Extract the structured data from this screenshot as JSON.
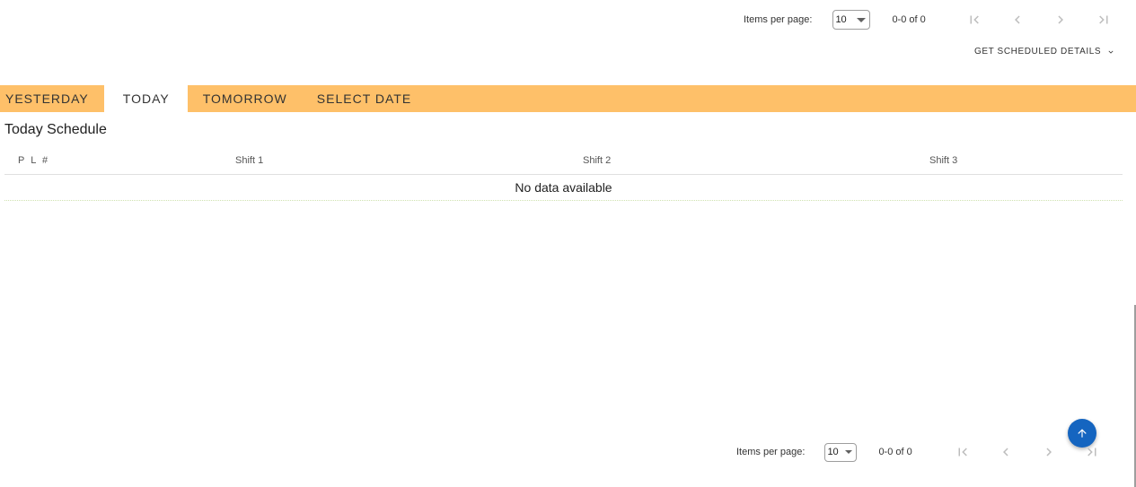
{
  "top_paginator": {
    "items_per_page_label": "Items per page:",
    "page_size": "10",
    "range": "0-0 of 0"
  },
  "details_toggle": {
    "label": "GET SCHEDULED DETAILS",
    "icon": "chevron-down-icon"
  },
  "tabs": [
    {
      "label": "YESTERDAY",
      "active": false
    },
    {
      "label": "TODAY",
      "active": true
    },
    {
      "label": "TOMORROW",
      "active": false
    },
    {
      "label": "SELECT DATE",
      "active": false
    }
  ],
  "section_title": "Today Schedule",
  "table": {
    "columns": [
      "P L #",
      "Shift 1",
      "Shift 2",
      "Shift 3"
    ],
    "empty_message": "No data available"
  },
  "bottom_paginator": {
    "items_per_page_label": "Items per page:",
    "page_size": "10",
    "range": "0-0 of 0"
  },
  "fab": {
    "icon": "arrow-up-icon"
  },
  "colors": {
    "tab_bar": "#fec069",
    "fab": "#1565c0",
    "disabled_icon": "#bdbdbd"
  }
}
